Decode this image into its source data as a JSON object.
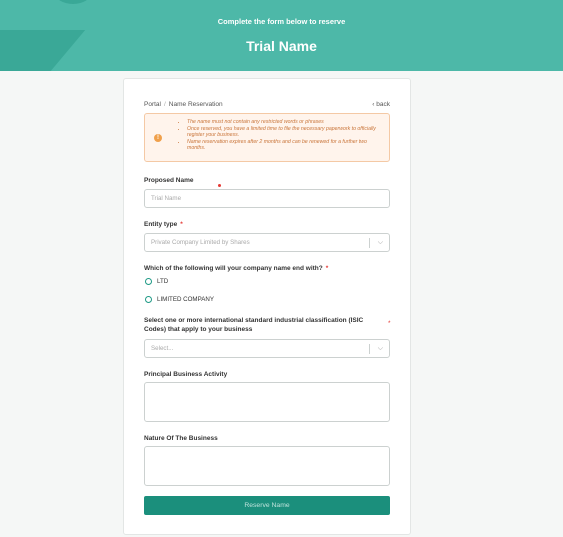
{
  "header": {
    "subtitle": "Complete the form below to reserve",
    "title": "Trial Name"
  },
  "breadcrumb": {
    "root": "Portal",
    "separator": "/",
    "current": "Name Reservation",
    "back": "back"
  },
  "alert": {
    "icon": "warning-icon",
    "items": [
      "The name must not contain any restricted words or phrases",
      "Once reserved, you have a limited time to file the necessary paperwork to officially register your business.",
      "Name reservation expires after 2 months and can be renewed for a further two months."
    ]
  },
  "form": {
    "proposed_name": {
      "label": "Proposed Name",
      "value": "Trial Name"
    },
    "entity_type": {
      "label": "Entity type",
      "required": "*",
      "value": "Private Company Limited by Shares"
    },
    "name_ending": {
      "label": "Which of the following will your company name end with?",
      "required": "*",
      "options": [
        "LTD",
        "LIMITED COMPANY"
      ]
    },
    "isic": {
      "label": "Select one or more international standard industrial classification (ISIC Codes) that apply to your business",
      "required": "*",
      "placeholder": "Select..."
    },
    "principal_activity": {
      "label": "Principal Business Activity",
      "value": ""
    },
    "nature_of_business": {
      "label": "Nature Of The Business",
      "value": ""
    },
    "submit_label": "Reserve Name"
  },
  "colors": {
    "header_bg": "#4db8a8",
    "accent": "#1b8f7c",
    "warning_bg": "#fff4ec",
    "warning_text": "#c9753a"
  }
}
